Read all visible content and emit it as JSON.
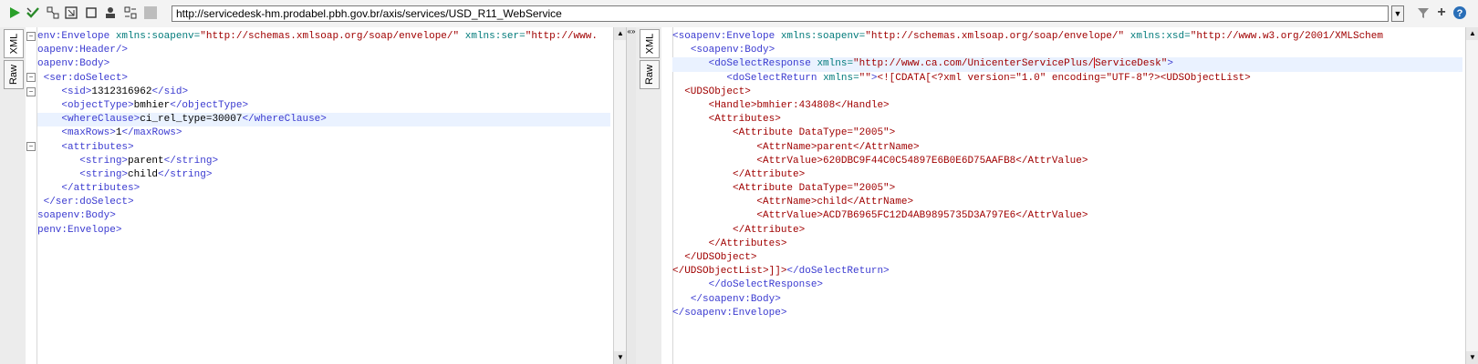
{
  "toolbar": {
    "url": "http://servicedesk-hm.prodabel.pbh.gov.br/axis/services/USD_R11_WebService",
    "icons": [
      "run-icon",
      "validate-icon",
      "wsa-icon",
      "expand-icon",
      "stop-icon",
      "user-icon",
      "settings-icon",
      "disabled-icon"
    ]
  },
  "tabs": {
    "xml": "XML",
    "raw": "Raw"
  },
  "request_lines": [
    {
      "indent": "",
      "t": [
        [
          "tag",
          "env:Envelope"
        ],
        [
          "plain",
          " "
        ],
        [
          "attr",
          "xmlns:soapenv="
        ],
        [
          "str",
          "\"http://schemas.xmlsoap.org/soap/envelope/\""
        ],
        [
          "plain",
          " "
        ],
        [
          "attr",
          "xmlns:ser="
        ],
        [
          "str",
          "\"http://www."
        ]
      ]
    },
    {
      "indent": "",
      "t": [
        [
          "tag",
          "oapenv:Header/>"
        ]
      ]
    },
    {
      "indent": "",
      "t": [
        [
          "tag",
          "oapenv:Body>"
        ]
      ]
    },
    {
      "indent": " ",
      "t": [
        [
          "tag",
          "<ser:doSelect>"
        ]
      ]
    },
    {
      "indent": "    ",
      "t": [
        [
          "tag",
          "<sid>"
        ],
        [
          "plain",
          "1312316962"
        ],
        [
          "tag",
          "</sid>"
        ]
      ]
    },
    {
      "indent": "    ",
      "t": [
        [
          "tag",
          "<objectType>"
        ],
        [
          "plain",
          "bmhier"
        ],
        [
          "tag",
          "</objectType>"
        ]
      ]
    },
    {
      "indent": "    ",
      "t": [
        [
          "tag",
          "<whereClause>"
        ],
        [
          "plain",
          "ci_rel_type=30007"
        ],
        [
          "tag",
          "</whereClause>"
        ]
      ],
      "hl": true
    },
    {
      "indent": "    ",
      "t": [
        [
          "tag",
          "<maxRows>"
        ],
        [
          "plain",
          "1"
        ],
        [
          "tag",
          "</maxRows>"
        ]
      ]
    },
    {
      "indent": "    ",
      "t": [
        [
          "tag",
          "<attributes>"
        ]
      ]
    },
    {
      "indent": "       ",
      "t": [
        [
          "tag",
          "<string>"
        ],
        [
          "plain",
          "parent"
        ],
        [
          "tag",
          "</string>"
        ]
      ]
    },
    {
      "indent": "       ",
      "t": [
        [
          "tag",
          "<string>"
        ],
        [
          "plain",
          "child"
        ],
        [
          "tag",
          "</string>"
        ]
      ]
    },
    {
      "indent": "    ",
      "t": [
        [
          "tag",
          "</attributes>"
        ]
      ]
    },
    {
      "indent": " ",
      "t": [
        [
          "tag",
          "</ser:doSelect>"
        ]
      ]
    },
    {
      "indent": "",
      "t": [
        [
          "tag",
          "soapenv:Body>"
        ]
      ]
    },
    {
      "indent": "",
      "t": [
        [
          "tag",
          "penv:Envelope>"
        ]
      ]
    }
  ],
  "response_lines": [
    {
      "indent": "",
      "t": [
        [
          "tag",
          "<soapenv:Envelope"
        ],
        [
          "plain",
          " "
        ],
        [
          "attr",
          "xmlns:soapenv="
        ],
        [
          "str",
          "\"http://schemas.xmlsoap.org/soap/envelope/\""
        ],
        [
          "plain",
          " "
        ],
        [
          "attr",
          "xmlns:xsd="
        ],
        [
          "str",
          "\"http://www.w3.org/2001/XMLSchem"
        ]
      ]
    },
    {
      "indent": "   ",
      "t": [
        [
          "tag",
          "<soapenv:Body>"
        ]
      ]
    },
    {
      "indent": "      ",
      "t": [
        [
          "tag",
          "<doSelectResponse"
        ],
        [
          "plain",
          " "
        ],
        [
          "attr",
          "xmlns="
        ],
        [
          "str",
          "\"http://www.ca.com/UnicenterServicePlus/"
        ],
        [
          "cursor",
          ""
        ],
        [
          "str",
          "ServiceDesk\""
        ],
        [
          "tag",
          ">"
        ]
      ],
      "hl": true
    },
    {
      "indent": "         ",
      "t": [
        [
          "tag",
          "<doSelectReturn"
        ],
        [
          "plain",
          " "
        ],
        [
          "attr",
          "xmlns="
        ],
        [
          "str",
          "\"\""
        ],
        [
          "tag",
          ">"
        ],
        [
          "xml",
          "<![CDATA[<?xml version=\"1.0\" encoding=\"UTF-8\"?><UDSObjectList>"
        ]
      ]
    },
    {
      "indent": "  ",
      "t": [
        [
          "xml",
          "<UDSObject>"
        ]
      ]
    },
    {
      "indent": "      ",
      "t": [
        [
          "xml",
          "<Handle>bmhier:434808</Handle>"
        ]
      ]
    },
    {
      "indent": "      ",
      "t": [
        [
          "xml",
          "<Attributes>"
        ]
      ]
    },
    {
      "indent": "          ",
      "t": [
        [
          "xml",
          "<Attribute DataType=\"2005\">"
        ]
      ]
    },
    {
      "indent": "              ",
      "t": [
        [
          "xml",
          "<AttrName>parent</AttrName>"
        ]
      ]
    },
    {
      "indent": "              ",
      "t": [
        [
          "xml",
          "<AttrValue>620DBC9F44C0C54897E6B0E6D75AAFB8</AttrValue>"
        ]
      ]
    },
    {
      "indent": "          ",
      "t": [
        [
          "xml",
          "</Attribute>"
        ]
      ]
    },
    {
      "indent": "          ",
      "t": [
        [
          "xml",
          "<Attribute DataType=\"2005\">"
        ]
      ]
    },
    {
      "indent": "              ",
      "t": [
        [
          "xml",
          "<AttrName>child</AttrName>"
        ]
      ]
    },
    {
      "indent": "              ",
      "t": [
        [
          "xml",
          "<AttrValue>ACD7B6965FC12D4AB9895735D3A797E6</AttrValue>"
        ]
      ]
    },
    {
      "indent": "          ",
      "t": [
        [
          "xml",
          "</Attribute>"
        ]
      ]
    },
    {
      "indent": "      ",
      "t": [
        [
          "xml",
          "</Attributes>"
        ]
      ]
    },
    {
      "indent": "  ",
      "t": [
        [
          "xml",
          "</UDSObject>"
        ]
      ]
    },
    {
      "indent": "",
      "t": [
        [
          "xml",
          "</UDSObjectList>]]>"
        ],
        [
          "tag",
          "</doSelectReturn>"
        ]
      ]
    },
    {
      "indent": "      ",
      "t": [
        [
          "tag",
          "</doSelectResponse>"
        ]
      ]
    },
    {
      "indent": "   ",
      "t": [
        [
          "tag",
          "</soapenv:Body>"
        ]
      ]
    },
    {
      "indent": "",
      "t": [
        [
          "tag",
          "</soapenv:Envelope>"
        ]
      ]
    }
  ]
}
